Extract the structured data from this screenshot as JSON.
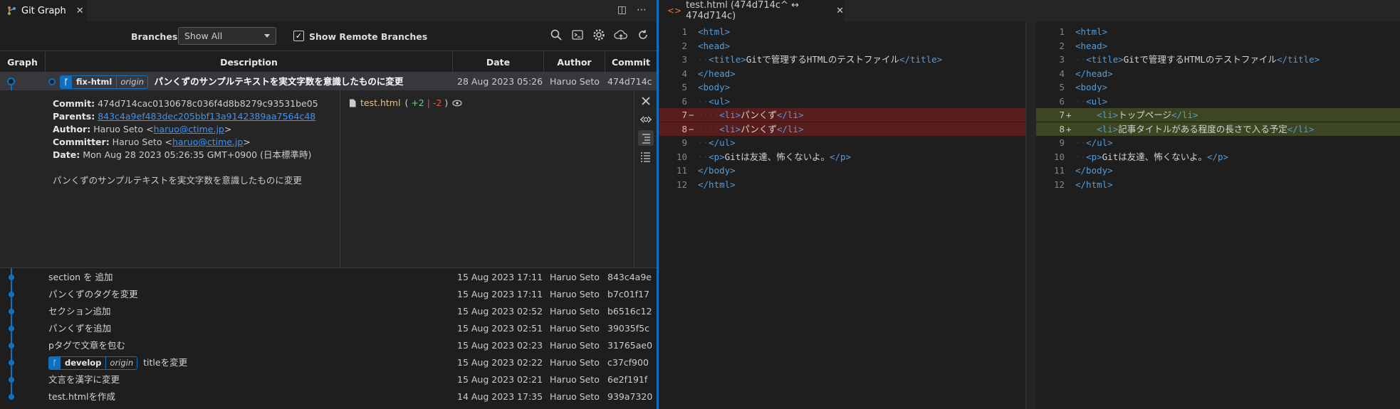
{
  "left_panel": {
    "tab": {
      "title": "Git Graph",
      "close": "✕"
    },
    "tab_actions": [
      "◫",
      "⋯"
    ],
    "controls": {
      "branches_label": "Branches:",
      "branches_value": "Show All",
      "show_remote_label": "Show Remote Branches",
      "show_remote_checked": "✓",
      "icons": [
        "search-icon",
        "terminal-icon",
        "gear-icon",
        "cloud-icon",
        "refresh-icon"
      ]
    },
    "columns": [
      "Graph",
      "Description",
      "Date",
      "Author",
      "Commit"
    ],
    "head_commit": {
      "branch": "fix-html",
      "remote": "origin",
      "message": "パンくずのサンプルテキストを実文字数を意識したものに変更",
      "date": "28 Aug 2023 05:26",
      "author": "Haruo Seto",
      "hash": "474d714c"
    },
    "details": {
      "commit_label": "Commit:",
      "commit_value": "474d714cac0130678c036f4d8b8279c93531be05",
      "parents_label": "Parents:",
      "parents_value": "843c4a9ef483dec205bbf13a9142389aa7564c48",
      "author_label": "Author:",
      "author_name": "Haruo Seto <",
      "author_email": "haruo@ctime.jp",
      "committer_label": "Committer:",
      "committer_name": "Haruo Seto <",
      "committer_email": "haruo@ctime.jp",
      "date_label": "Date:",
      "date_value": "Mon Aug 28 2023 05:26:35 GMT+0900 (日本標準時)",
      "message": "パンくずのサンプルテキストを実文字数を意識したものに変更",
      "file": {
        "name": "test.html",
        "open": "(",
        "added": "+2",
        "sep": "|",
        "deleted": "-2",
        "close": ")"
      }
    },
    "commits": [
      {
        "message": "section を 追加",
        "date": "15 Aug 2023 17:11",
        "author": "Haruo Seto",
        "hash": "843c4a9e"
      },
      {
        "message": "パンくずのタグを変更",
        "date": "15 Aug 2023 17:11",
        "author": "Haruo Seto",
        "hash": "b7c01f17"
      },
      {
        "message": "セクション追加",
        "date": "15 Aug 2023 02:52",
        "author": "Haruo Seto",
        "hash": "b6516c12"
      },
      {
        "message": "パンくずを追加",
        "date": "15 Aug 2023 02:51",
        "author": "Haruo Seto",
        "hash": "39035f5c"
      },
      {
        "message": "pタグで文章を包む",
        "date": "15 Aug 2023 02:23",
        "author": "Haruo Seto",
        "hash": "31765ae0"
      },
      {
        "branch": "develop",
        "remote": "origin",
        "message": "titleを変更",
        "date": "15 Aug 2023 02:22",
        "author": "Haruo Seto",
        "hash": "c37cf900"
      },
      {
        "message": "文言を漢字に変更",
        "date": "15 Aug 2023 02:21",
        "author": "Haruo Seto",
        "hash": "6e2f191f"
      },
      {
        "message": "test.htmlを作成",
        "date": "14 Aug 2023 17:35",
        "author": "Haruo Seto",
        "hash": "939a7320"
      }
    ]
  },
  "right_panel": {
    "tab": {
      "title": "test.html (474d714c^ ↔ 474d714c)",
      "close": "✕"
    },
    "left_lines": [
      {
        "n": "1",
        "mk": "",
        "code": "<html>"
      },
      {
        "n": "2",
        "mk": "",
        "code": "<head>"
      },
      {
        "n": "3",
        "mk": "",
        "code": "  <title>Gitで管理するHTMLのテストファイル</title>"
      },
      {
        "n": "4",
        "mk": "",
        "code": "</head>"
      },
      {
        "n": "5",
        "mk": "",
        "code": "<body>"
      },
      {
        "n": "6",
        "mk": "",
        "code": "  <ul>"
      },
      {
        "n": "7",
        "mk": "−",
        "code": "    <li>パンくず</li>",
        "kind": "del"
      },
      {
        "n": "8",
        "mk": "−",
        "code": "    <li>パンくず</li>",
        "kind": "del"
      },
      {
        "n": "9",
        "mk": "",
        "code": "  </ul>"
      },
      {
        "n": "10",
        "mk": "",
        "code": "  <p>Gitは友達、怖くないよ。</p>"
      },
      {
        "n": "11",
        "mk": "",
        "code": "</body>"
      },
      {
        "n": "12",
        "mk": "",
        "code": "</html>"
      }
    ],
    "right_lines": [
      {
        "n": "1",
        "mk": "",
        "code": "<html>"
      },
      {
        "n": "2",
        "mk": "",
        "code": "<head>"
      },
      {
        "n": "3",
        "mk": "",
        "code": "  <title>Gitで管理するHTMLのテストファイル</title>"
      },
      {
        "n": "4",
        "mk": "",
        "code": "</head>"
      },
      {
        "n": "5",
        "mk": "",
        "code": "<body>"
      },
      {
        "n": "6",
        "mk": "",
        "code": "  <ul>"
      },
      {
        "n": "7",
        "mk": "+",
        "code": "    <li>トップページ</li>",
        "kind": "add"
      },
      {
        "n": "8",
        "mk": "+",
        "code": "    <li>記事タイトルがある程度の長さで入る予定</li>",
        "kind": "add"
      },
      {
        "n": "9",
        "mk": "",
        "code": "  </ul>"
      },
      {
        "n": "10",
        "mk": "",
        "code": "  <p>Gitは友達、怖くないよ。</p>"
      },
      {
        "n": "11",
        "mk": "",
        "code": "</body>"
      },
      {
        "n": "12",
        "mk": "",
        "code": "</html>"
      }
    ]
  },
  "colors": {
    "accent": "#0e70c0",
    "deleted_bg": "#5a1d1d",
    "added_bg": "#3d4a1f",
    "link": "#3794ff"
  }
}
